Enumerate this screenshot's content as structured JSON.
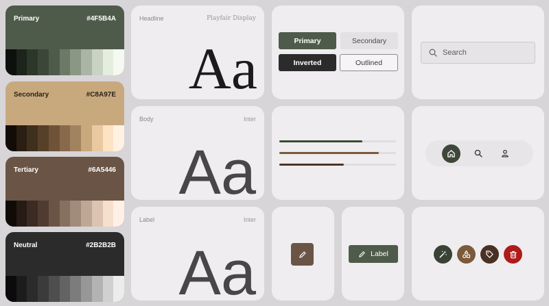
{
  "palettes": [
    {
      "name": "Primary",
      "hex": "#4F5B4A",
      "text_color": "#ffffff",
      "tones": [
        "#0d100c",
        "#1d241b",
        "#2c3629",
        "#3b4638",
        "#4F5B4A",
        "#6b7a66",
        "#8a9785",
        "#aab5a5",
        "#c9d3c4",
        "#e4edde",
        "#f5f9f2"
      ]
    },
    {
      "name": "Secondary",
      "hex": "#C8A97E",
      "text_color": "#2b2218",
      "tones": [
        "#120c06",
        "#2a1f12",
        "#3f2f1d",
        "#564029",
        "#6e5339",
        "#88694b",
        "#a3825f",
        "#c8a97e",
        "#e8c9a0",
        "#fde3c3",
        "#fff2e3"
      ]
    },
    {
      "name": "Tertiary",
      "hex": "#6A5446",
      "text_color": "#ffffff",
      "tones": [
        "#110b08",
        "#271b15",
        "#3b2b22",
        "#503b30",
        "#6A5446",
        "#86705f",
        "#a28b7a",
        "#bfa796",
        "#ddc3b2",
        "#f6dfcd",
        "#fff0e6"
      ]
    },
    {
      "name": "Neutral",
      "hex": "#2B2B2B",
      "text_color": "#ffffff",
      "tones": [
        "#0b0b0b",
        "#1c1c1c",
        "#2b2b2b",
        "#3b3b3b",
        "#4e4e4e",
        "#636363",
        "#7c7c7c",
        "#979797",
        "#b3b3b3",
        "#d0d0d0",
        "#ececec"
      ]
    }
  ],
  "typography": {
    "headline": {
      "label": "Headline",
      "font": "Playfair Display",
      "sample": "Aa"
    },
    "body": {
      "label": "Body",
      "font": "Inter",
      "sample": "Aa"
    },
    "label": {
      "label": "Label",
      "font": "Inter",
      "sample": "Aa"
    }
  },
  "buttons": {
    "primary": "Primary",
    "secondary": "Secondary",
    "inverted": "Inverted",
    "outlined": "Outlined"
  },
  "search": {
    "placeholder": "Search"
  },
  "progress": [
    {
      "value": 0.71,
      "color": "#3a4a34"
    },
    {
      "value": 0.85,
      "color": "#7a5a3a"
    },
    {
      "value": 0.55,
      "color": "#4a3528"
    }
  ],
  "nav": {
    "items": [
      "home-icon",
      "search-icon",
      "person-icon"
    ],
    "active_color": "#3f473b"
  },
  "fab": {
    "icon": "pencil-icon",
    "color": "#6A5446"
  },
  "extended_fab": {
    "icon": "pencil-icon",
    "label": "Label",
    "color": "#4F5B4A"
  },
  "icon_buttons": [
    {
      "icon": "magic-wand-icon",
      "color": "#3a4236"
    },
    {
      "icon": "shapes-icon",
      "color": "#7a5a3a"
    },
    {
      "icon": "tag-icon",
      "color": "#4a3024"
    },
    {
      "icon": "trash-icon",
      "color": "#b01a1a"
    }
  ]
}
